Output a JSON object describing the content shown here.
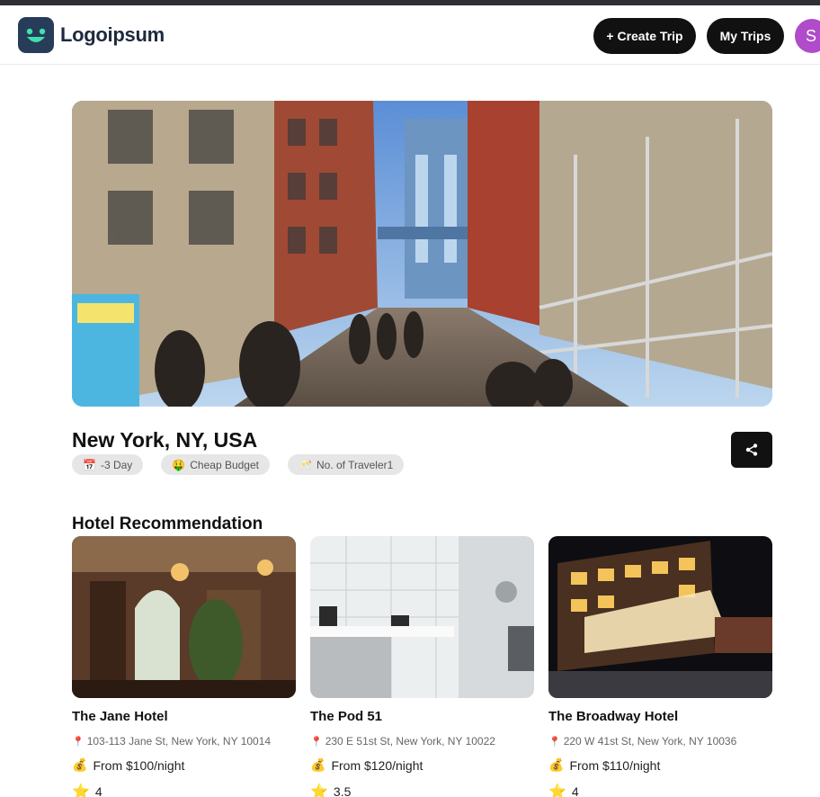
{
  "header": {
    "logo_text": "Logoipsum",
    "create_trip_label": "+ Create Trip",
    "my_trips_label": "My Trips",
    "avatar_initial": "S"
  },
  "trip": {
    "title": "New York, NY, USA",
    "chips": [
      {
        "icon": "calendar-icon",
        "label": "-3 Day"
      },
      {
        "icon": "money-face-icon",
        "label": "Cheap Budget"
      },
      {
        "icon": "travelers-icon",
        "label": "No. of Traveler1"
      }
    ]
  },
  "hotels_section": {
    "title": "Hotel Recommendation",
    "hotels": [
      {
        "name": "The Jane Hotel",
        "address": "103-113 Jane St, New York, NY 10014",
        "price": "From $100/night",
        "rating": "4"
      },
      {
        "name": "The Pod 51",
        "address": "230 E 51st St, New York, NY 10022",
        "price": "From $120/night",
        "rating": "3.5"
      },
      {
        "name": "The Broadway Hotel",
        "address": "220 W 41st St, New York, NY 10036",
        "price": "From $110/night",
        "rating": "4"
      }
    ]
  },
  "colors": {
    "button_bg": "#111111",
    "avatar_bg": "#b04bc9",
    "logo_bg": "#273c59",
    "logo_accent": "#3fe0b0",
    "chip_bg": "#e6e6e6"
  }
}
